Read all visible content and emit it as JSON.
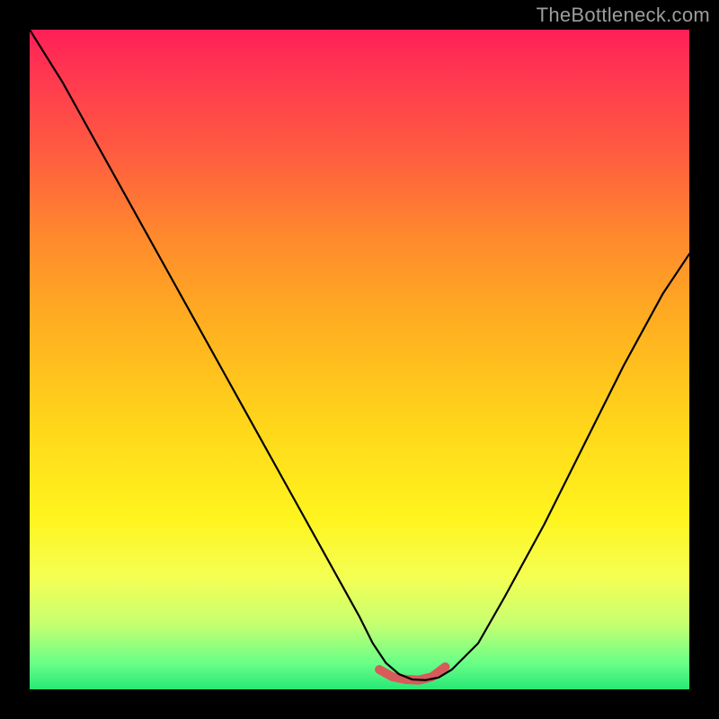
{
  "watermark": "TheBottleneck.com",
  "chart_data": {
    "type": "line",
    "title": "",
    "xlabel": "",
    "ylabel": "",
    "xlim": [
      0,
      100
    ],
    "ylim": [
      0,
      100
    ],
    "grid": false,
    "legend": false,
    "series": [
      {
        "name": "curve",
        "x": [
          0,
          5,
          10,
          15,
          20,
          25,
          30,
          35,
          40,
          45,
          50,
          52,
          54,
          56,
          58,
          60,
          62,
          64,
          68,
          72,
          78,
          84,
          90,
          96,
          100
        ],
        "y": [
          100,
          92,
          83,
          74,
          65,
          56,
          47,
          38,
          29,
          20,
          11,
          7,
          4,
          2.3,
          1.5,
          1.4,
          1.8,
          3,
          7,
          14,
          25,
          37,
          49,
          60,
          66
        ]
      }
    ],
    "highlight": {
      "name": "bottom-marker",
      "x": [
        53,
        55,
        57,
        59,
        61,
        63
      ],
      "y": [
        3.0,
        1.9,
        1.5,
        1.4,
        1.9,
        3.4
      ],
      "color": "#d85a5a"
    },
    "background_gradient_stops": [
      {
        "pos": 0.0,
        "color": "#ff1f57"
      },
      {
        "pos": 0.07,
        "color": "#ff3850"
      },
      {
        "pos": 0.18,
        "color": "#ff5a41"
      },
      {
        "pos": 0.32,
        "color": "#ff8b2c"
      },
      {
        "pos": 0.45,
        "color": "#ffb020"
      },
      {
        "pos": 0.6,
        "color": "#ffd61a"
      },
      {
        "pos": 0.74,
        "color": "#fff41e"
      },
      {
        "pos": 0.83,
        "color": "#f4ff53"
      },
      {
        "pos": 0.9,
        "color": "#c7ff70"
      },
      {
        "pos": 0.96,
        "color": "#6aff88"
      },
      {
        "pos": 1.0,
        "color": "#27e876"
      }
    ]
  }
}
